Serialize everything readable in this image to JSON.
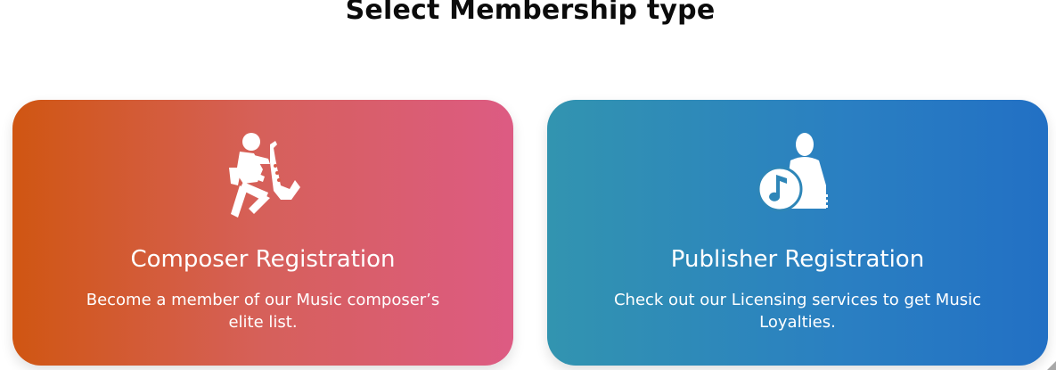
{
  "page": {
    "title": "Select Membership type"
  },
  "cards": [
    {
      "title": "Composer Registration",
      "description": "Become a member of our Music composer’s elite list.",
      "icon": "saxophone-player-icon",
      "gradient": [
        "#d05612",
        "#dd5b83"
      ]
    },
    {
      "title": "Publisher Registration",
      "description": "Check out our Licensing services to get Music Loyalties.",
      "icon": "music-publisher-icon",
      "gradient": [
        "#3294b0",
        "#2270c4"
      ]
    }
  ]
}
